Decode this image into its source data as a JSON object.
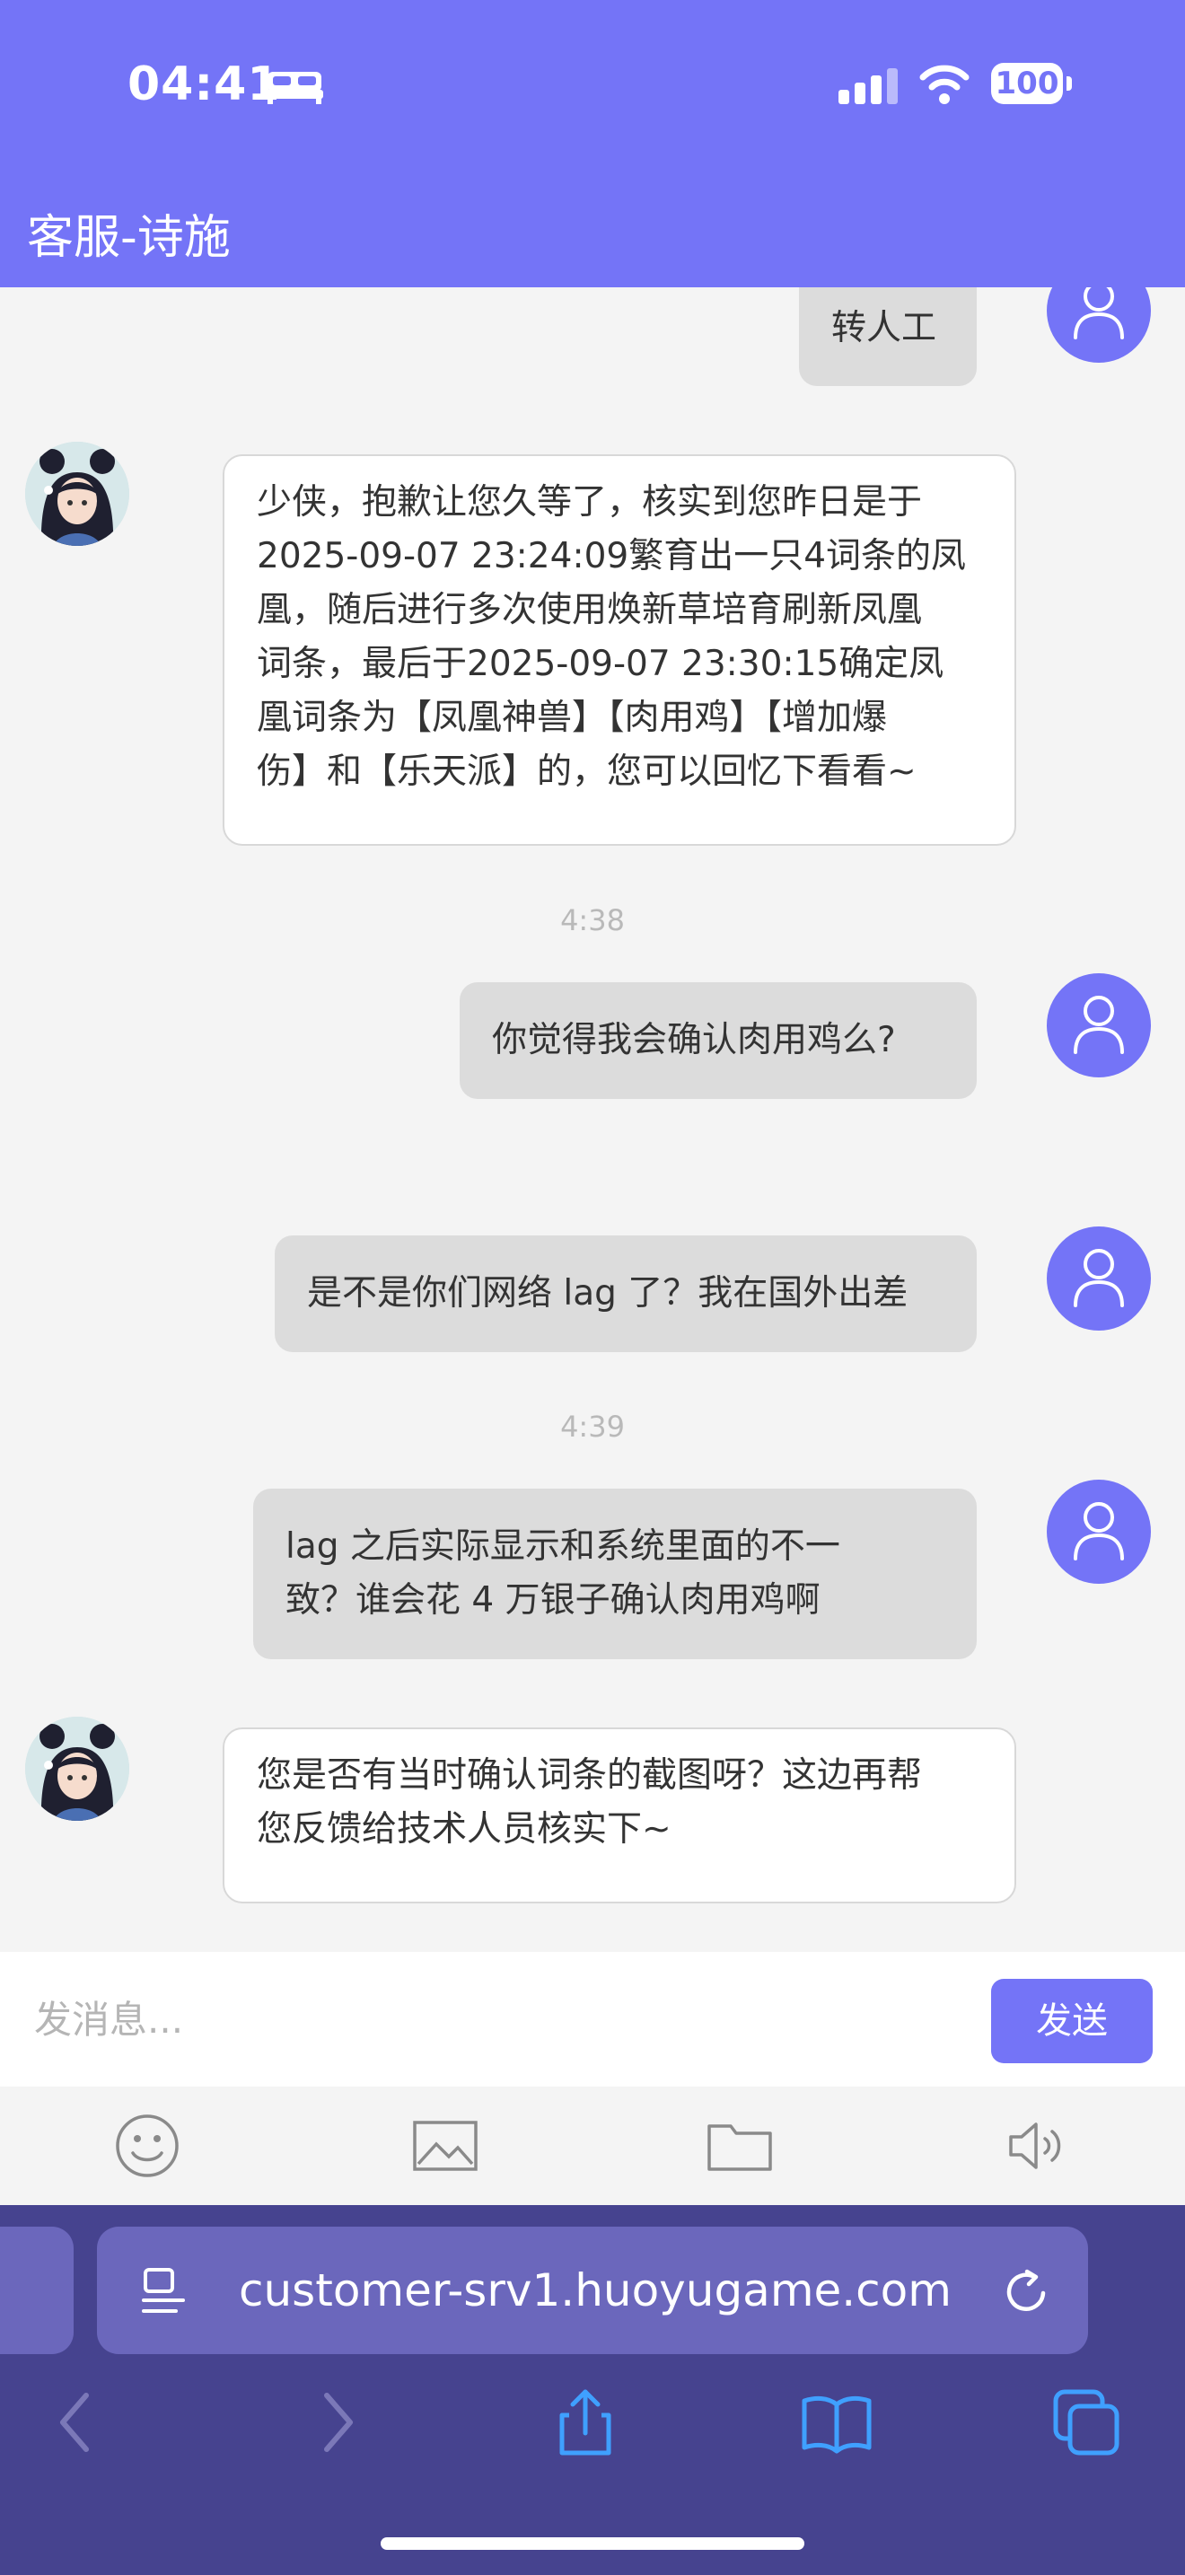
{
  "status": {
    "time": "04:41",
    "battery": "100",
    "icons": [
      "bed-icon",
      "signal-icon",
      "wifi-icon",
      "battery-icon"
    ]
  },
  "header": {
    "title": "客服-诗施"
  },
  "messages": [
    {
      "sender": "user",
      "lines": [
        "转人工"
      ]
    },
    {
      "sender": "agent",
      "lines": [
        "少侠，抱歉让您久等了，核实到您昨日是于",
        "2025-09-07 23:24:09繁育出一只4词条的凤",
        "凰，随后进行多次使用焕新草培育刷新凤凰",
        "词条，最后于2025-09-07 23:30:15确定凤",
        "凰词条为【凤凰神兽】【肉用鸡】【增加爆",
        "伤】和【乐天派】的，您可以回忆下看看~"
      ]
    },
    {
      "sender": "time",
      "text": "4:38"
    },
    {
      "sender": "user",
      "lines": [
        "你觉得我会确认肉用鸡么?"
      ]
    },
    {
      "sender": "user",
      "lines": [
        "是不是你们网络 lag 了？我在国外出差"
      ]
    },
    {
      "sender": "time",
      "text": "4:39"
    },
    {
      "sender": "user",
      "lines": [
        "lag 之后实际显示和系统里面的不一",
        "致？谁会花 4 万银子确认肉用鸡啊"
      ]
    },
    {
      "sender": "agent",
      "lines": [
        "您是否有当时确认词条的截图呀？这边再帮",
        "您反馈给技术人员核实下~"
      ]
    }
  ],
  "composer": {
    "placeholder": "发消息...",
    "send_label": "发送"
  },
  "toolbar": {
    "icons": [
      "emoji-icon",
      "image-icon",
      "folder-icon",
      "audio-icon"
    ]
  },
  "browser": {
    "url": "customer-srv1.huoyugame.com",
    "icons": [
      "back-icon",
      "forward-icon",
      "share-icon",
      "bookmarks-icon",
      "tabs-icon"
    ]
  },
  "colors": {
    "accent": "#7474f7",
    "browser_bar": "#46438f",
    "user_bubble": "#dcdcdc",
    "agent_bubble": "#ffffff"
  }
}
